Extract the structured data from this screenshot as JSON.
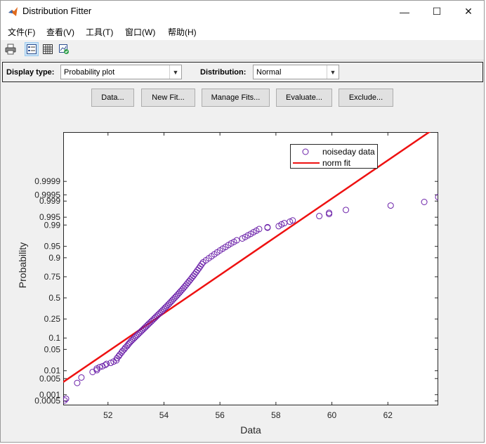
{
  "window": {
    "title": "Distribution Fitter",
    "minimize_glyph": "—",
    "maximize_glyph": "☐",
    "close_glyph": "✕"
  },
  "menu": [
    "文件(F)",
    "查看(V)",
    "工具(T)",
    "窗口(W)",
    "帮助(H)"
  ],
  "toolbar": {
    "icons": [
      "print-icon",
      "legend-icon",
      "grid-icon",
      "axes-toggle-icon"
    ]
  },
  "controls": {
    "display_type_label": "Display type:",
    "display_type_value": "Probability plot",
    "distribution_label": "Distribution:",
    "distribution_value": "Normal"
  },
  "buttons": [
    "Data...",
    "New Fit...",
    "Manage Fits...",
    "Evaluate...",
    "Exclude..."
  ],
  "colors": {
    "data": "#6a1fa8",
    "fit": "#ee1111"
  },
  "chart_data": {
    "type": "scatter",
    "subtype": "normal probability plot",
    "xlabel": "Data",
    "ylabel": "Probability",
    "xlim": [
      50.4,
      63.8
    ],
    "xticks": [
      52,
      54,
      56,
      58,
      60,
      62
    ],
    "yticks": [
      "0.0005",
      "0.001",
      "0.005",
      "0.01",
      "0.05",
      "0.1",
      "0.25",
      "0.5",
      "0.75",
      "0.9",
      "0.95",
      "0.99",
      "0.995",
      "0.999",
      "0.9995",
      "0.9999"
    ],
    "ytick_values": [
      0.0005,
      0.001,
      0.005,
      0.01,
      0.05,
      0.1,
      0.25,
      0.5,
      0.75,
      0.9,
      0.95,
      0.99,
      0.995,
      0.999,
      0.9995,
      0.9999
    ],
    "legend_position": "top-right",
    "series": [
      {
        "name": "noiseday data",
        "marker": "circle",
        "x": [
          50.45,
          50.5,
          50.9,
          51.05,
          51.45,
          51.6,
          51.6,
          51.7,
          51.8,
          51.9,
          51.95,
          52.1,
          52.2,
          52.3,
          52.32,
          52.38,
          52.42,
          52.48,
          52.52,
          52.58,
          52.62,
          52.68,
          52.72,
          52.76,
          52.8,
          52.85,
          52.9,
          52.95,
          53.0,
          53.05,
          53.1,
          53.15,
          53.2,
          53.25,
          53.3,
          53.35,
          53.4,
          53.45,
          53.5,
          53.55,
          53.6,
          53.65,
          53.7,
          53.75,
          53.8,
          53.85,
          53.9,
          53.95,
          54.0,
          54.05,
          54.1,
          54.15,
          54.2,
          54.25,
          54.3,
          54.35,
          54.4,
          54.45,
          54.5,
          54.55,
          54.6,
          54.65,
          54.7,
          54.75,
          54.8,
          54.85,
          54.9,
          54.95,
          55.0,
          55.05,
          55.1,
          55.15,
          55.2,
          55.25,
          55.3,
          55.35,
          55.4,
          55.5,
          55.6,
          55.7,
          55.8,
          55.9,
          56.0,
          56.1,
          56.2,
          56.3,
          56.4,
          56.5,
          56.6,
          56.8,
          56.9,
          57.0,
          57.1,
          57.2,
          57.3,
          57.4,
          57.7,
          57.7,
          58.1,
          58.2,
          58.3,
          58.5,
          58.6,
          59.55,
          59.9,
          59.9,
          60.5,
          62.1,
          63.3,
          63.8
        ],
        "p": [
          0.00053,
          0.00064,
          0.0033,
          0.0055,
          0.009,
          0.0105,
          0.012,
          0.0135,
          0.0145,
          0.016,
          0.0175,
          0.019,
          0.021,
          0.023,
          0.027,
          0.031,
          0.035,
          0.04,
          0.045,
          0.05,
          0.056,
          0.062,
          0.068,
          0.074,
          0.08,
          0.087,
          0.094,
          0.102,
          0.11,
          0.118,
          0.127,
          0.136,
          0.146,
          0.156,
          0.167,
          0.178,
          0.19,
          0.202,
          0.214,
          0.227,
          0.24,
          0.254,
          0.268,
          0.283,
          0.298,
          0.313,
          0.329,
          0.345,
          0.362,
          0.379,
          0.396,
          0.414,
          0.432,
          0.45,
          0.469,
          0.488,
          0.507,
          0.526,
          0.545,
          0.565,
          0.585,
          0.604,
          0.624,
          0.644,
          0.664,
          0.684,
          0.703,
          0.722,
          0.741,
          0.759,
          0.777,
          0.795,
          0.812,
          0.828,
          0.844,
          0.859,
          0.872,
          0.885,
          0.897,
          0.908,
          0.918,
          0.927,
          0.935,
          0.942,
          0.948,
          0.954,
          0.959,
          0.963,
          0.967,
          0.971,
          0.974,
          0.977,
          0.9795,
          0.982,
          0.984,
          0.986,
          0.9875,
          0.988,
          0.989,
          0.9905,
          0.9915,
          0.9925,
          0.9933,
          0.9955,
          0.9963,
          0.9967,
          0.9975,
          0.9984,
          0.9989,
          0.99935
        ]
      },
      {
        "name": "norm fit",
        "line": true,
        "x": [
          50.4,
          63.8
        ],
        "p": [
          0.0036,
          0.99999998
        ]
      }
    ]
  }
}
